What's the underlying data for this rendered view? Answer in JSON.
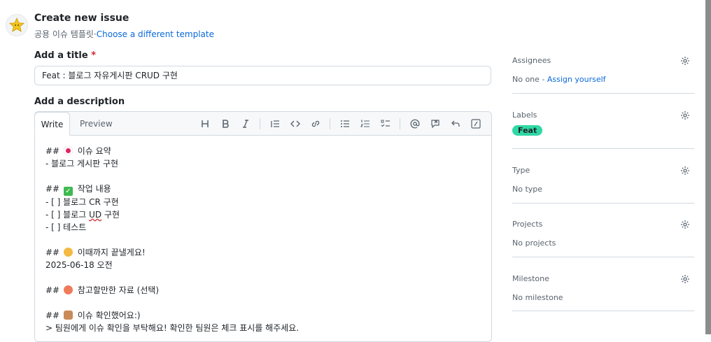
{
  "header": {
    "title": "Create new issue",
    "template_name": "공용 이슈 템플릿",
    "separator": " · ",
    "change_template": "Choose a different template"
  },
  "title_field": {
    "label": "Add a title",
    "required_mark": "*",
    "value": "Feat : 블로그 자유게시판 CRUD 구현"
  },
  "description": {
    "label": "Add a description",
    "tabs": [
      "Write",
      "Preview"
    ],
    "lines": {
      "l1a": "## ",
      "l1b": " 이슈 요약",
      "l2": "- 블로그 게시판 구현",
      "l4a": "## ",
      "l4b": " 작업 내용",
      "l5": "- [ ] 블로그 CR 구현",
      "l6a": "- [ ] 블로그 ",
      "l6b": "UD",
      "l6c": " 구현",
      "l7": "- [ ] 테스트",
      "l9a": "## ",
      "l9b": " 이때까지 끝낼게요!",
      "l10": "2025-06-18 오전",
      "l12a": "## ",
      "l12b": " 참고할만한 자료 (선택)",
      "l14a": "## ",
      "l14b": " 이슈 확인했어요:)",
      "l15": "> 팀원에게 이슈 확인을 부탁해요! 확인한 팀원은 체크 표시를 해주세요."
    }
  },
  "sidebar": {
    "assignees": {
      "title": "Assignees",
      "value": "No one - ",
      "action": "Assign yourself"
    },
    "labels": {
      "title": "Labels",
      "tag": "Feat",
      "tag_color": "#2fd8a4"
    },
    "type": {
      "title": "Type",
      "value": "No type"
    },
    "projects": {
      "title": "Projects",
      "value": "No projects"
    },
    "milestone": {
      "title": "Milestone",
      "value": "No milestone"
    }
  },
  "icons": [
    "star-avatar-icon",
    "heading-icon",
    "bold-icon",
    "italic-icon",
    "quote-icon",
    "code-icon",
    "link-icon",
    "bullet-list-icon",
    "numbered-list-icon",
    "task-list-icon",
    "mention-icon",
    "reference-icon",
    "undo-icon",
    "slash-command-icon",
    "gear-icon"
  ]
}
